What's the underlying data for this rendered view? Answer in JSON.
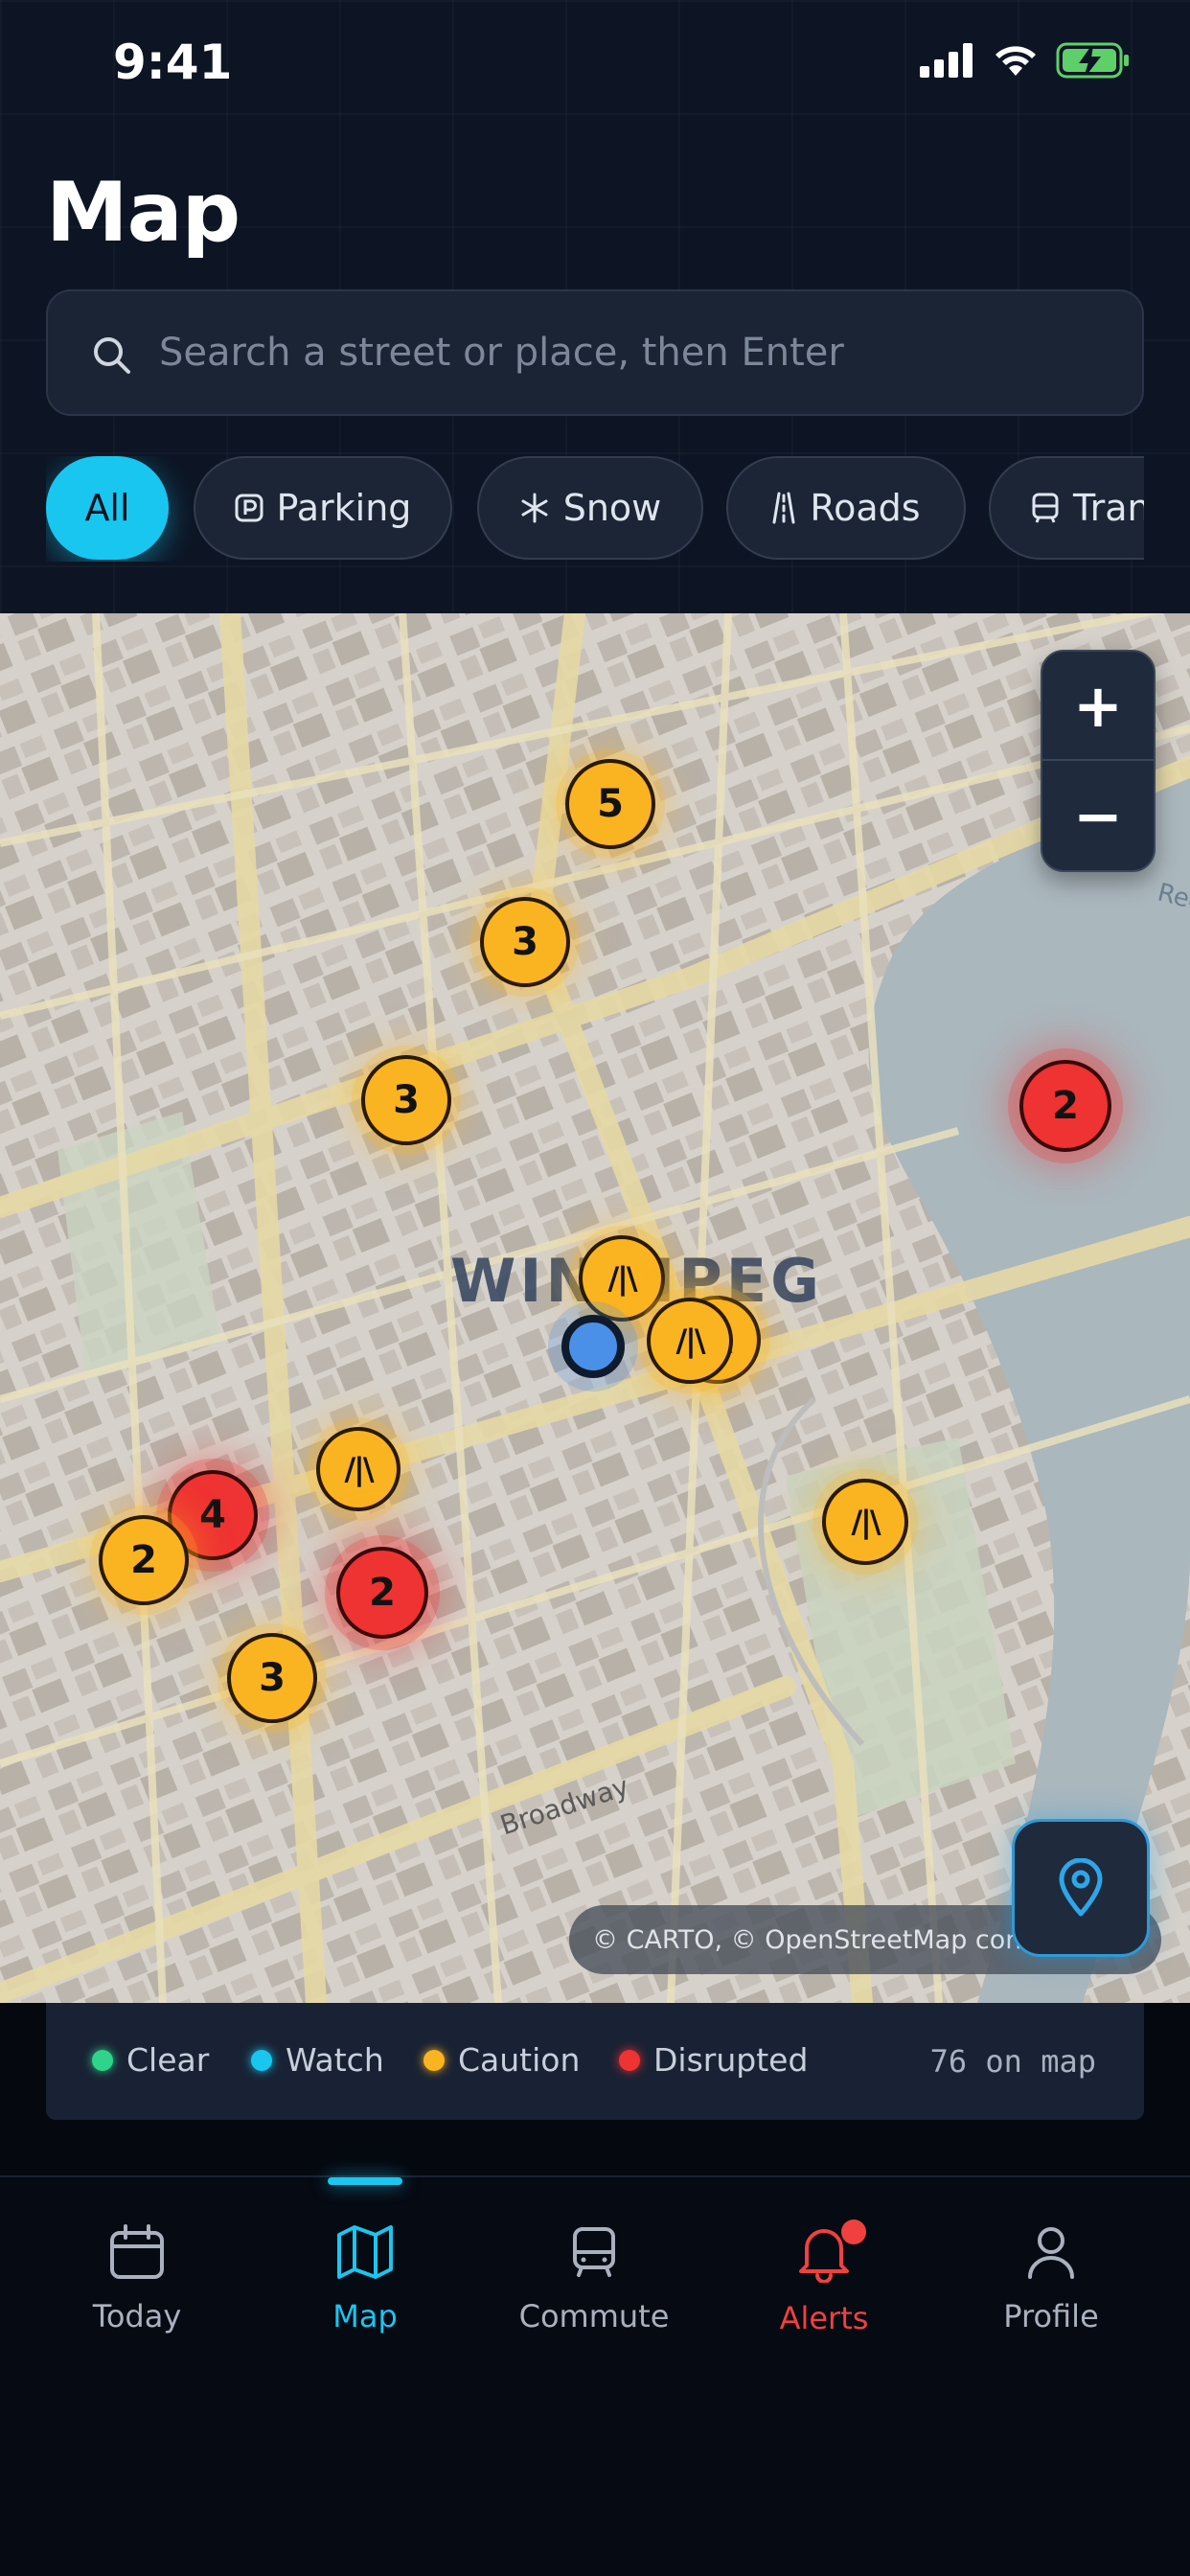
{
  "status_bar": {
    "time": "9:41"
  },
  "header": {
    "title": "Map"
  },
  "search": {
    "placeholder": "Search a street or place, then Enter",
    "value": ""
  },
  "filters": [
    {
      "label": "All",
      "icon": "none",
      "active": true
    },
    {
      "label": "Parking",
      "icon": "parking-icon",
      "active": false
    },
    {
      "label": "Snow",
      "icon": "snowflake-icon",
      "active": false
    },
    {
      "label": "Roads",
      "icon": "road-icon",
      "active": false
    },
    {
      "label": "Transit",
      "icon": "bus-icon",
      "active": false
    }
  ],
  "map": {
    "city_label": "WINNIPEG",
    "street_label": "Broadway",
    "river_label": "Red",
    "attribution": "© CARTO, © OpenStreetMap contributors",
    "zoom_in": "+",
    "zoom_out": "−",
    "markers": [
      {
        "label": "5",
        "status": "caution"
      },
      {
        "label": "3",
        "status": "caution"
      },
      {
        "label": "3",
        "status": "caution"
      },
      {
        "label": "2",
        "status": "disrupted"
      },
      {
        "label": "/|\\",
        "status": "caution"
      },
      {
        "label": "/|\\",
        "status": "caution"
      },
      {
        "label": "/|\\",
        "status": "caution"
      },
      {
        "label": "/|\\",
        "status": "caution"
      },
      {
        "label": "/|\\",
        "status": "caution"
      },
      {
        "label": "4",
        "status": "disrupted"
      },
      {
        "label": "2",
        "status": "caution"
      },
      {
        "label": "2",
        "status": "disrupted"
      },
      {
        "label": "3",
        "status": "caution"
      }
    ]
  },
  "legend": {
    "items": [
      {
        "label": "Clear",
        "color": "#2fd48a"
      },
      {
        "label": "Watch",
        "color": "#19c6f0"
      },
      {
        "label": "Caution",
        "color": "#fbb421"
      },
      {
        "label": "Disrupted",
        "color": "#ef3232"
      }
    ],
    "count": "76 on map"
  },
  "tabs": [
    {
      "label": "Today",
      "icon": "calendar-icon"
    },
    {
      "label": "Map",
      "icon": "map-icon"
    },
    {
      "label": "Commute",
      "icon": "bus-icon"
    },
    {
      "label": "Alerts",
      "icon": "bell-icon"
    },
    {
      "label": "Profile",
      "icon": "profile-icon"
    }
  ],
  "colors": {
    "accent": "#19c6f0",
    "caution": "#fbb421",
    "disrupted": "#ef3232",
    "alert": "#f04040"
  }
}
